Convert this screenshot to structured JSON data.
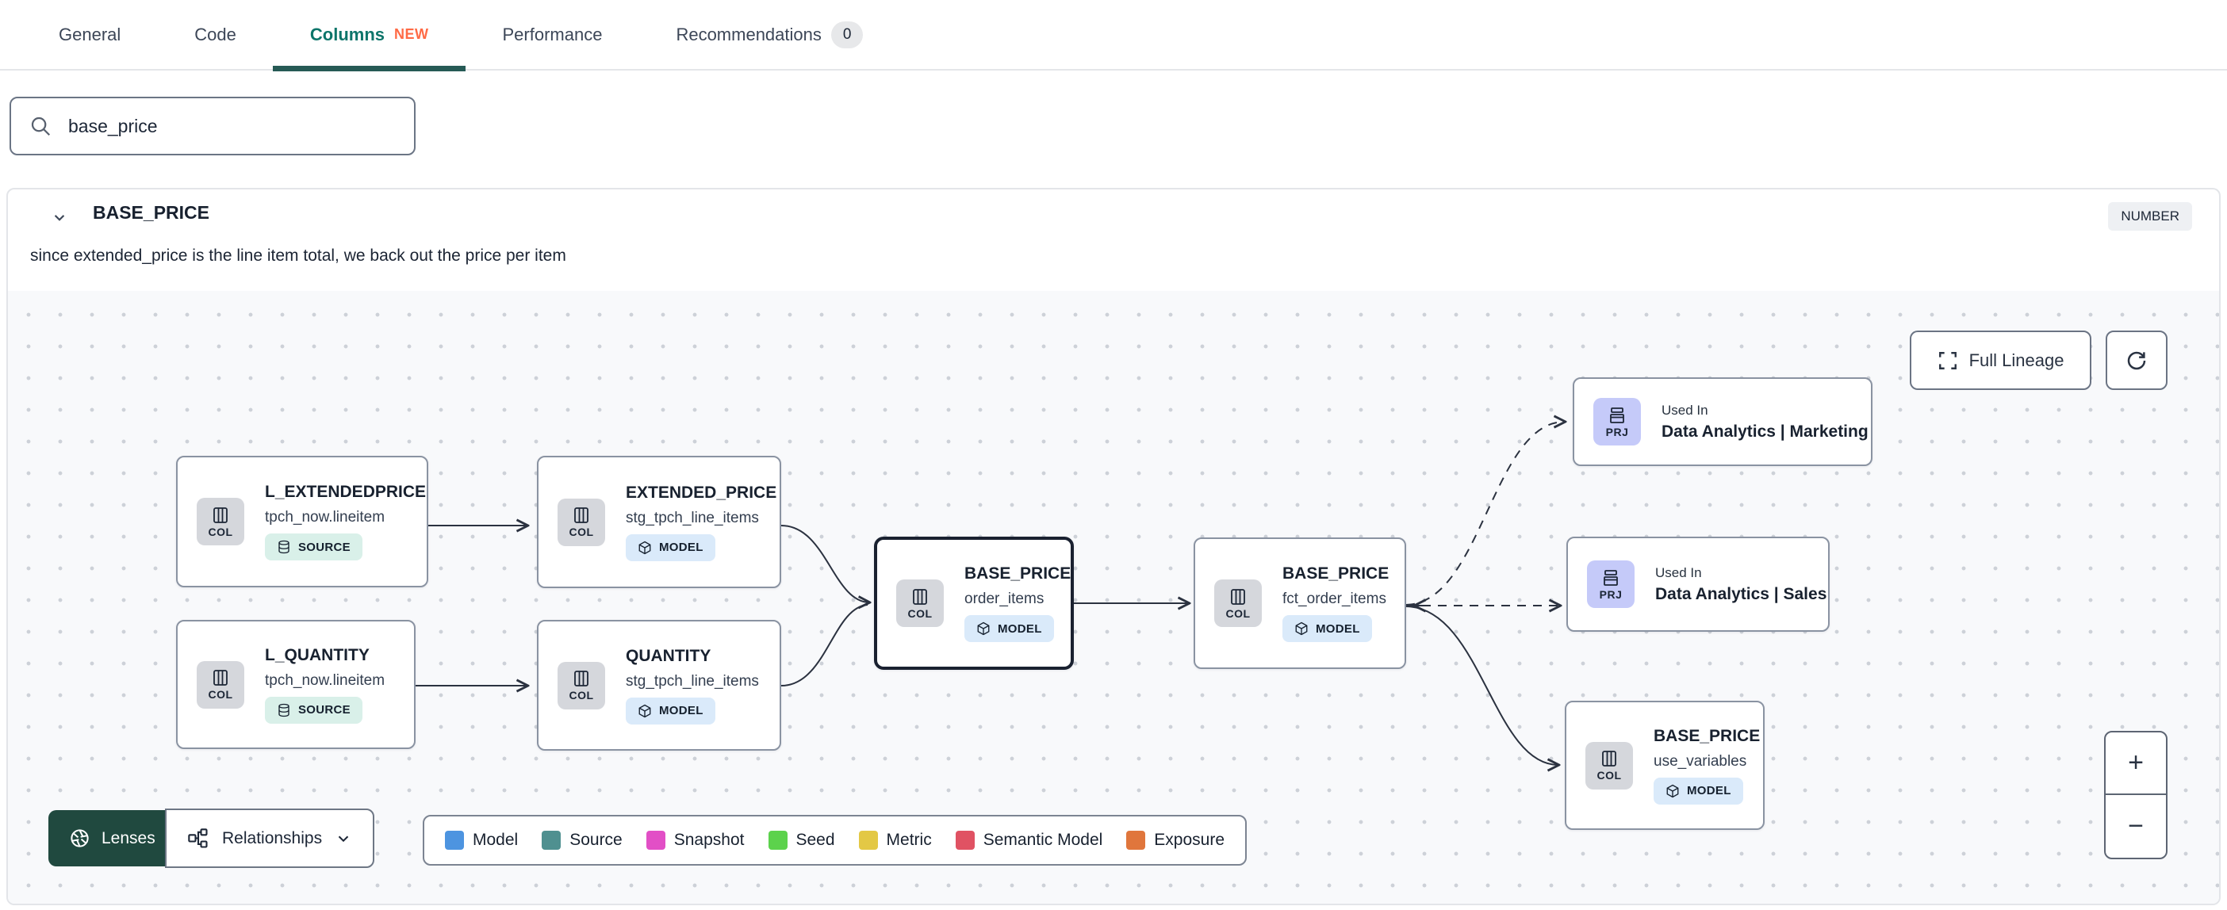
{
  "tabs": {
    "general": "General",
    "code": "Code",
    "columns": "Columns",
    "columns_badge": "NEW",
    "performance": "Performance",
    "recommendations": "Recommendations",
    "recommendations_count": "0"
  },
  "search": {
    "value": "base_price"
  },
  "column_panel": {
    "name": "BASE_PRICE",
    "type_badge": "NUMBER",
    "description": "since extended_price is the line item total, we back out the price per item"
  },
  "lineage": {
    "controls": {
      "full_lineage_label": "Full Lineage",
      "zoom_in_label": "+",
      "zoom_out_label": "−"
    },
    "toolbar": {
      "lenses_label": "Lenses",
      "relationships_label": "Relationships"
    },
    "legend": {
      "items": [
        {
          "label": "Model",
          "color": "#4d94e0"
        },
        {
          "label": "Source",
          "color": "#4f9090"
        },
        {
          "label": "Snapshot",
          "color": "#e24fc6"
        },
        {
          "label": "Seed",
          "color": "#5cd24c"
        },
        {
          "label": "Metric",
          "color": "#e3c845"
        },
        {
          "label": "Semantic Model",
          "color": "#e05263"
        },
        {
          "label": "Exposure",
          "color": "#e0763c"
        }
      ]
    },
    "nodes": [
      {
        "kind": "COL",
        "title": "L_EXTENDEDPRICE",
        "subtitle": "tpch_now.lineitem",
        "badge": "SOURCE"
      },
      {
        "kind": "COL",
        "title": "L_QUANTITY",
        "subtitle": "tpch_now.lineitem",
        "badge": "SOURCE"
      },
      {
        "kind": "COL",
        "title": "EXTENDED_PRICE",
        "subtitle": "stg_tpch_line_items",
        "badge": "MODEL"
      },
      {
        "kind": "COL",
        "title": "QUANTITY",
        "subtitle": "stg_tpch_line_items",
        "badge": "MODEL"
      },
      {
        "kind": "COL",
        "title": "BASE_PRICE",
        "subtitle": "order_items",
        "badge": "MODEL"
      },
      {
        "kind": "COL",
        "title": "BASE_PRICE",
        "subtitle": "fct_order_items",
        "badge": "MODEL"
      },
      {
        "kind": "PRJ",
        "label": "Used In",
        "title": "Data Analytics | Marketing"
      },
      {
        "kind": "PRJ",
        "label": "Used In",
        "title": "Data Analytics | Sales"
      },
      {
        "kind": "COL",
        "title": "BASE_PRICE",
        "subtitle": "use_variables",
        "badge": "MODEL"
      }
    ]
  },
  "colors": {
    "accent_teal": "#0d756a",
    "underline_teal": "#265a55",
    "new_badge": "#ff6a45",
    "lenses_green": "#20493f",
    "model_badge_bg": "#daeafa",
    "source_badge_bg": "#d9f0e9",
    "col_icon_bg": "#d5d7dc",
    "prj_icon_bg": "#c5caf9",
    "selected_border": "#1a2130"
  }
}
